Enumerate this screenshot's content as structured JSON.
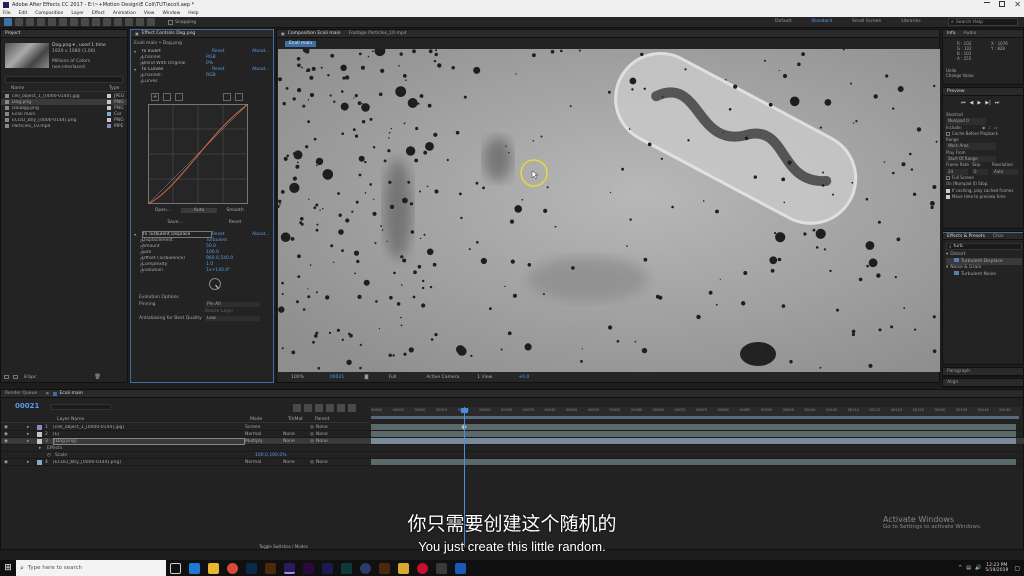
{
  "titlebar": {
    "title": "Adobe After Effects CC 2017 - E:\\~+Motion Design\\E Coli\\TUT\\ecoli.aep *"
  },
  "menu": [
    "File",
    "Edit",
    "Composition",
    "Layer",
    "Effect",
    "Animation",
    "View",
    "Window",
    "Help"
  ],
  "toolbar": {
    "snapping_label": "Snapping",
    "workspaces": [
      "Default",
      "Standard",
      "Small Screen",
      "Libraries"
    ],
    "search_placeholder": "Search Help"
  },
  "project": {
    "tab_label": "Project",
    "selected_name": "Dog.png ▾ , used 1 time",
    "selected_dims": "1920 x 1080 (1.00)",
    "selected_colors": "Millions of Colors",
    "selected_interlace": "non-interlaced",
    "header_name": "Name",
    "header_type": "Type",
    "items": [
      {
        "name": "cell_object_1_[0000-0144].jpg",
        "type": "JPEG"
      },
      {
        "name": "Dog.png",
        "type": "PNG"
      },
      {
        "name": "Doubgy.png",
        "type": "PNG"
      },
      {
        "name": "Ecoli main",
        "type": "Cor"
      },
      {
        "name": "ECOLI_btiy_[0000-0144].png",
        "type": "PNG"
      },
      {
        "name": "Particles_10.mp4",
        "type": "MPE"
      }
    ],
    "bpc": "8 bpc"
  },
  "effect_controls": {
    "tab_label": "Effect Controls Dog.png",
    "breadcrumb": "Ecoli main • Dog.png",
    "sections": [
      {
        "name": "fx Invert",
        "value": "Reset",
        "extra": "About..."
      },
      {
        "name": "Channel",
        "value": "RGB",
        "extra": ""
      },
      {
        "name": "Blend With Original",
        "value": "0%",
        "extra": ""
      },
      {
        "name": "fx Curves",
        "value": "Reset",
        "extra": "About..."
      },
      {
        "name": "Channel:",
        "value": "RGB",
        "extra": ""
      },
      {
        "name": "Curves",
        "value": "",
        "extra": ""
      }
    ],
    "curve_buttons": [
      "Open...",
      "Auto",
      "Smooth"
    ],
    "curve_buttons2": [
      "Save...",
      "Reset"
    ],
    "turbulent": [
      {
        "name": "fx Turbulent Displace",
        "value": "Reset",
        "extra": "About..."
      },
      {
        "name": "Displacement",
        "value": "Turbulent",
        "extra": ""
      },
      {
        "name": "Amount",
        "value": "50.0",
        "extra": ""
      },
      {
        "name": "Size",
        "value": "100.0",
        "extra": ""
      },
      {
        "name": "Offset (Turbulence)",
        "value": "960.0,540.0",
        "extra": ""
      },
      {
        "name": "Complexity",
        "value": "1.0",
        "extra": ""
      },
      {
        "name": "Evolution",
        "value": "1x+140.0°",
        "extra": ""
      }
    ],
    "evolution_options": "Evolution Options",
    "pinning_label": "Pinning",
    "pinning_value": "Pin All",
    "resize_label": "Resize Layer",
    "antialias_label": "Antialiasing for Best Quality",
    "antialias_value": "Low"
  },
  "composition": {
    "tab_label": "Composition Ecoli main",
    "footage_tab": "Footage Particles_10.mp4",
    "subtab": "Ecoli main",
    "footer": {
      "zoom": "100%",
      "timecode": "00021",
      "resolution": "Full",
      "camera": "Active Camera",
      "views": "1 View",
      "exposure": "+0.0"
    }
  },
  "info": {
    "tabs": [
      "Info",
      "Audio"
    ],
    "r": "R : 102",
    "g": "G : 102",
    "b": "B : 102",
    "a": "A : 255",
    "x": "X : 1076",
    "y": "Y : 828",
    "undo1": "Undo",
    "undo2": "Change Value"
  },
  "preview": {
    "label": "Preview",
    "shortcut_label": "Shortcut",
    "shortcut_value": "Numpad 0",
    "include_label": "Include:",
    "cache_label": "Cache Before Playback",
    "range_label": "Range",
    "range_value": "Work Area",
    "playfrom_label": "Play From",
    "playfrom_value": "Start Of Range",
    "framerate_label": "Frame Rate",
    "skip_label": "Skip",
    "resolution_label": "Resolution",
    "framerate_value": "24",
    "skip_value": "0",
    "resolution_value": "Auto",
    "fullscreen_label": "Full Screen",
    "onstop_label": "On (Numpad 0) Stop:",
    "ifcaching_label": "If caching, play cached frames",
    "movetime_label": "Move time to preview time"
  },
  "effects_presets": {
    "tabs": [
      "Effects & Presets",
      "Char"
    ],
    "search_value": "turb",
    "groups": [
      {
        "group": "Distort",
        "item": "Turbulent Displace"
      },
      {
        "group": "Noise & Grain",
        "item": "Turbulent Noise"
      }
    ]
  },
  "paragraph_label": "Paragraph",
  "align_label": "Align",
  "timeline": {
    "render_queue_tab": "Render Queue",
    "comp_tab": "Ecoli main",
    "timecode": "00021",
    "header_layer": "Layer Name",
    "header_mode": "Mode",
    "header_trkmat": "TrkMat",
    "header_parent": "Parent",
    "layers": [
      {
        "num": "1",
        "name": "[cell_object_1_[0000-0144].jpg]",
        "mode": "Screen",
        "trk": "",
        "parent": "None"
      },
      {
        "num": "2",
        "name": "[E]",
        "mode": "Normal",
        "trk": "None",
        "parent": "None"
      },
      {
        "num": "3",
        "name": "[Dog.png]",
        "mode": "Multiply",
        "trk": "None",
        "parent": "None"
      },
      {
        "num": "4",
        "name": "[ECOLI_btiy_[0000-0144].png]",
        "mode": "Normal",
        "trk": "None",
        "parent": "None"
      }
    ],
    "effects_label": "Effects",
    "scale_label": "Scale",
    "scale_value": "100.0,100.0%",
    "ruler": [
      "00000",
      "00005",
      "00010",
      "00015",
      "00020",
      "00025",
      "00030",
      "00035",
      "00040",
      "00045",
      "00050",
      "00055",
      "00060",
      "00065",
      "00070",
      "00075",
      "00080",
      "00085",
      "00090",
      "00095",
      "00100",
      "00105",
      "00110",
      "00115",
      "00120",
      "00125",
      "00130",
      "00135",
      "00140",
      "00145"
    ],
    "toggle_label": "Toggle Switches / Modes"
  },
  "subtitles": {
    "zh": "你只需要创建这个随机的",
    "en": "You just create this little random."
  },
  "activate": {
    "line1": "Activate Windows",
    "line2": "Go to Settings to activate Windows."
  },
  "taskbar": {
    "search_placeholder": "Type here to search",
    "time": "12:23 PM",
    "date": "5/19/2019"
  },
  "colors": {
    "accent_blue": "#5a9ce6",
    "highlight_gold": "#e8d83a",
    "panel_bg": "#232323"
  }
}
